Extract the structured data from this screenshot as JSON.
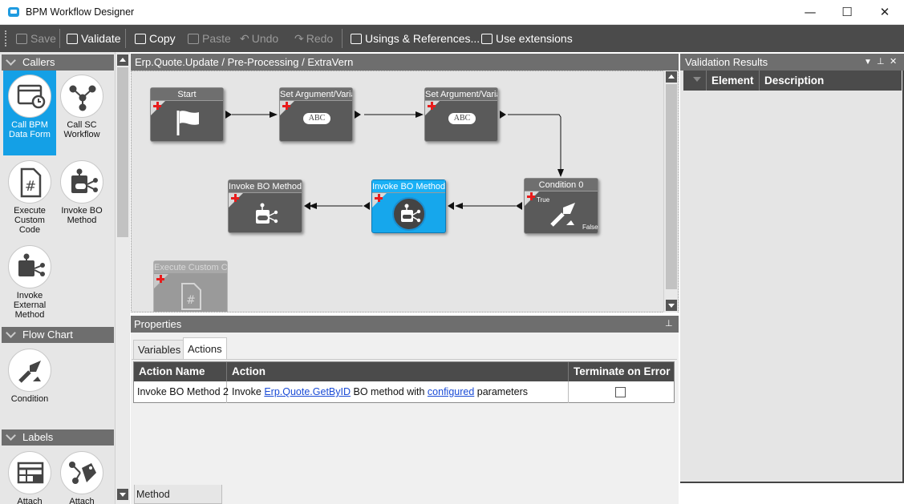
{
  "window": {
    "title": "BPM Workflow Designer",
    "controls": {
      "minimize": "—",
      "maximize": "☐",
      "close": "✕"
    }
  },
  "toolbar": {
    "save": "Save",
    "validate": "Validate",
    "copy": "Copy",
    "paste": "Paste",
    "undo": "Undo",
    "redo": "Redo",
    "usings": "Usings & References...",
    "extensions": "Use extensions"
  },
  "toolbox": {
    "callers": {
      "header": "Callers",
      "items": [
        {
          "label": "Call BPM Data Form",
          "icon": "data-form-icon",
          "selected": true
        },
        {
          "label": "Call SC Workflow",
          "icon": "workflow-icon"
        },
        {
          "label": "Execute Custom Code",
          "icon": "custom-code-icon"
        },
        {
          "label": "Invoke BO Method",
          "icon": "bo-method-icon"
        },
        {
          "label": "Invoke External Method",
          "icon": "external-method-icon"
        }
      ]
    },
    "flowchart": {
      "header": "Flow Chart",
      "items": [
        {
          "label": "Condition",
          "icon": "condition-icon"
        }
      ]
    },
    "labels": {
      "header": "Labels",
      "items": [
        {
          "label": "Attach",
          "icon": "attach-table-icon"
        },
        {
          "label": "Attach",
          "icon": "attach-tag-icon"
        }
      ]
    }
  },
  "designer": {
    "breadcrumb": "Erp.Quote.Update / Pre-Processing / ExtraVern",
    "nodes": {
      "start": "Start",
      "set_arg_1": "Set Argument/Variable",
      "set_arg_2": "Set Argument/Variable",
      "condition": "Condition 0",
      "condition_true": "True",
      "condition_false": "False",
      "invoke_2": "Invoke BO Method",
      "invoke_1": "Invoke BO Method",
      "execute_custom": "Execute Custom Code",
      "abc": "ABC"
    }
  },
  "properties": {
    "header": "Properties",
    "tabs": [
      {
        "label": "Variables",
        "active": false
      },
      {
        "label": "Actions",
        "active": true
      }
    ],
    "grid": {
      "columns": [
        "Action Name",
        "Action",
        "Terminate on Error"
      ],
      "row": {
        "name": "Invoke BO Method 2",
        "action_prefix": "Invoke",
        "action_link1": "Erp.Quote.GetByID",
        "action_middle": "BO method with",
        "action_link2": "configured",
        "action_suffix": "parameters",
        "terminate": false
      }
    },
    "bottom_tab": "Method parameters"
  },
  "validation": {
    "header": "Validation Results",
    "columns": [
      "Element",
      "Description"
    ]
  },
  "colors": {
    "accent": "#14a0e6",
    "toolbar": "#4b4b4b",
    "panel_header": "#6e6e6e",
    "node": "#5a5a5a",
    "error_plus": "#e81c1c",
    "link": "#1a4bd6"
  }
}
